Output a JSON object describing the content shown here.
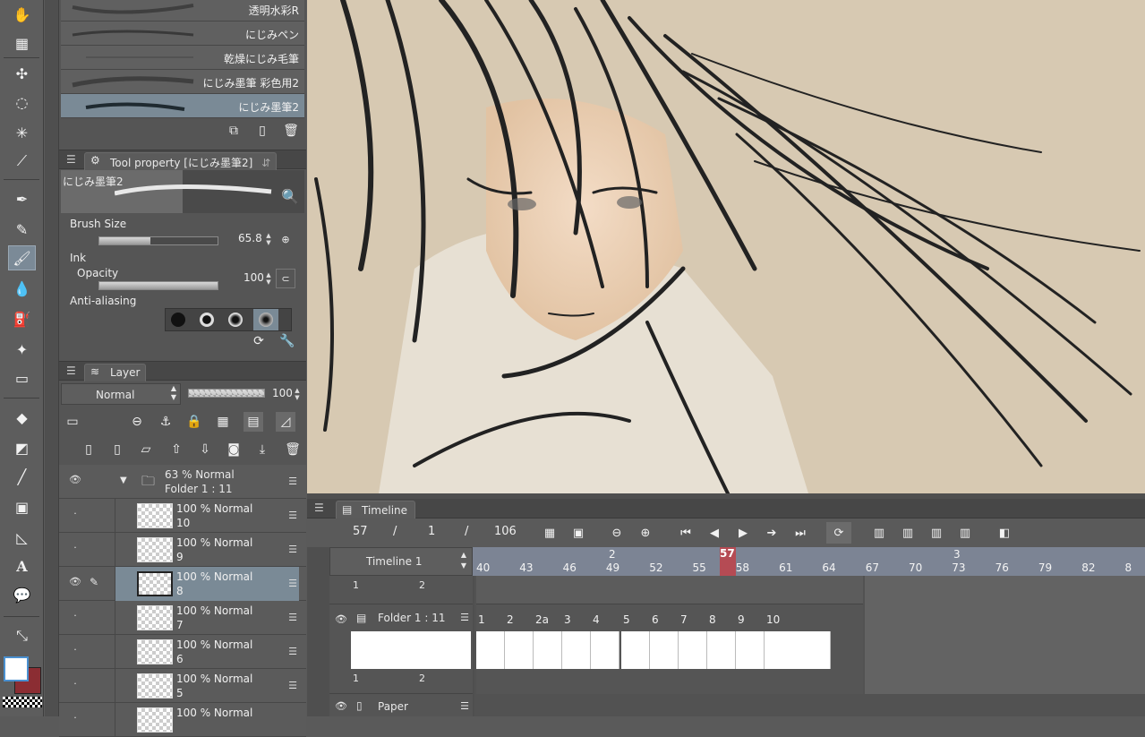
{
  "toolbar": {
    "tools": [
      "hand-icon",
      "zoom-grid-icon",
      "move-icon",
      "lasso-icon",
      "magic-wand-icon",
      "eyedropper-icon",
      "pen-icon",
      "pencil-icon",
      "brush-icon",
      "water-drop-icon",
      "airbrush-icon",
      "sparkle-icon",
      "eraser-icon",
      "fill-icon",
      "gradient-icon",
      "line-icon",
      "frame-icon",
      "ruler-icon",
      "text-icon",
      "balloon-icon",
      "correction-icon"
    ],
    "main_color": "#ffffff",
    "sub_color": "#8b2d33"
  },
  "brushes": {
    "items": [
      "透明水彩R",
      "にじみペン",
      "乾燥にじみ毛筆",
      "にじみ墨筆 彩色用2",
      "にじみ墨筆2"
    ],
    "selected_index": 4
  },
  "tool_property": {
    "title": "Tool property [にじみ墨筆2]",
    "preview_name": "にじみ墨筆2",
    "brush_size_label": "Brush Size",
    "brush_size_value": "65.8",
    "brush_size_fraction": 0.43,
    "ink_label": "Ink",
    "opacity_label": "Opacity",
    "opacity_value": "100",
    "opacity_fraction": 1.0,
    "antialias_label": "Anti-aliasing"
  },
  "layer_panel": {
    "tab": "Layer",
    "blend_mode": "Normal",
    "opacity": "100",
    "opacity_fraction": 1.0,
    "rows": [
      {
        "line1": "63 % Normal",
        "line2": "Folder 1 : 11",
        "type": "folder",
        "visible": true
      },
      {
        "line1": "100 % Normal",
        "line2": "10",
        "visible": false
      },
      {
        "line1": "100 % Normal",
        "line2": "9",
        "visible": false
      },
      {
        "line1": "100 % Normal",
        "line2": "8",
        "visible": true,
        "selected": true
      },
      {
        "line1": "100 % Normal",
        "line2": "7",
        "visible": false
      },
      {
        "line1": "100 % Normal",
        "line2": "6",
        "visible": false
      },
      {
        "line1": "100 % Normal",
        "line2": "5",
        "visible": false
      },
      {
        "line1": "100 % Normal",
        "line2": "",
        "visible": false
      }
    ]
  },
  "timeline": {
    "tab": "Timeline",
    "current_frame": "57",
    "slash1": "/",
    "value2": "1",
    "slash2": "/",
    "total_frames": "106",
    "name": "Timeline 1",
    "ruler_ticks": [
      "40",
      "43",
      "46",
      "49",
      "52",
      "55",
      "58",
      "61",
      "64",
      "67",
      "70",
      "73",
      "76",
      "79",
      "82",
      "8"
    ],
    "ruler_marker_2": "2",
    "ruler_marker_3": "3",
    "playhead": "57",
    "track_top_labels": [
      "1",
      "2"
    ],
    "track_folder": "Folder 1 : 11",
    "track_paper": "Paper",
    "cel_labels": [
      "1",
      "2",
      "2a",
      "3",
      "4",
      "5",
      "6",
      "7",
      "8",
      "9",
      "10"
    ],
    "preview_labels_top": [
      "1",
      "2"
    ],
    "preview_labels_bottom": [
      "1",
      "2"
    ]
  },
  "colors": {
    "canvas_bg": "#d7c9b2",
    "selection": "#7a8a96",
    "playhead": "#c8383f"
  }
}
